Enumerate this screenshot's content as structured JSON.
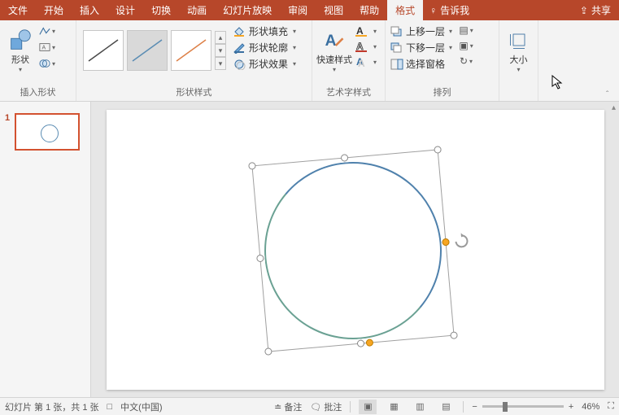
{
  "menu": {
    "tabs": [
      "文件",
      "开始",
      "插入",
      "设计",
      "切换",
      "动画",
      "幻灯片放映",
      "审阅",
      "视图",
      "帮助",
      "格式"
    ],
    "active_index": 10,
    "tell_me": "告诉我",
    "share": "共享"
  },
  "ribbon": {
    "insert_shapes": {
      "label": "插入形状",
      "shape_btn": "形状"
    },
    "shape_styles": {
      "label": "形状样式",
      "fill": "形状填充",
      "outline": "形状轮廓",
      "effects": "形状效果"
    },
    "wordart_styles": {
      "label": "艺术字样式",
      "quick_styles": "快速样式"
    },
    "arrange": {
      "label": "排列",
      "bring_forward": "上移一层",
      "send_backward": "下移一层",
      "selection_pane": "选择窗格"
    },
    "size": {
      "label": "大小"
    }
  },
  "thumbnails": {
    "slide1_number": "1"
  },
  "status": {
    "slide_info": "幻灯片 第 1 张，共 1 张",
    "language": "中文(中国)",
    "notes": "备注",
    "comments": "批注",
    "zoom_value": "46%"
  },
  "colors": {
    "accent": "#b7472a"
  }
}
